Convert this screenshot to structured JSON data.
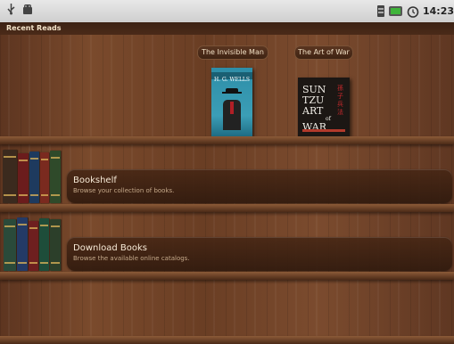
{
  "status_bar": {
    "time": "14:23",
    "icons": [
      "usb-icon",
      "android-debug-icon",
      "sd-card-icon",
      "battery-icon",
      "alarm-clock-icon"
    ]
  },
  "recent_reads": {
    "title": "Recent Reads",
    "books": [
      {
        "title": "The Invisible Man",
        "cover_author": "H. G. WELLS",
        "cover_color": "#2e8ea8"
      },
      {
        "title": "The Art of War",
        "cover_lines": [
          "SUN",
          "TZU",
          "ART",
          "WAR"
        ],
        "cover_small": "of",
        "cover_color": "#1c1714"
      }
    ]
  },
  "menu": [
    {
      "title": "Bookshelf",
      "subtitle": "Browse your collection of books."
    },
    {
      "title": "Download Books",
      "subtitle": "Browse the available online catalogs."
    }
  ],
  "colors": {
    "wood": "#6b3f25",
    "panel": "#3e2213",
    "title_text": "#f7ead7"
  }
}
